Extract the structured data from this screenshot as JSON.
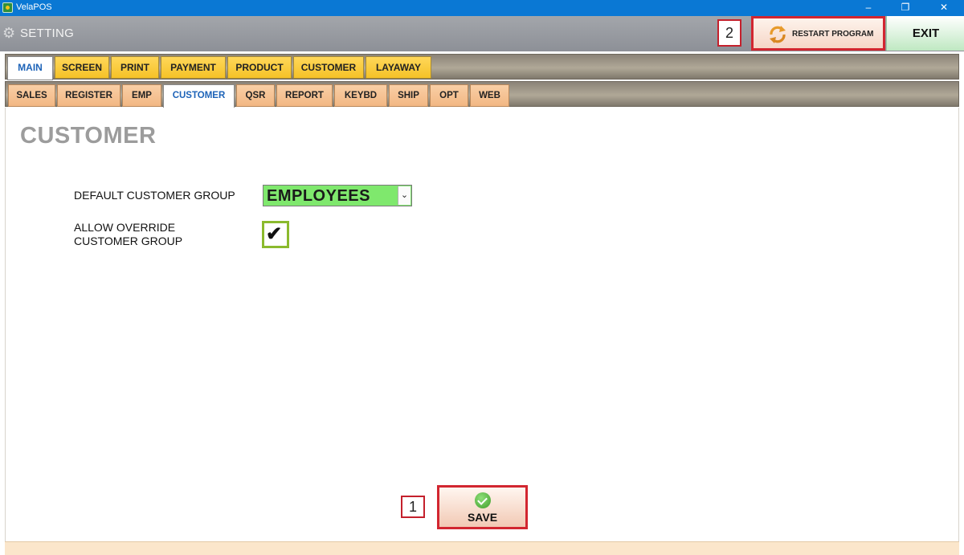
{
  "window": {
    "title": "VelaPOS",
    "min": "–",
    "max": "❐",
    "close": "✕"
  },
  "header": {
    "title": "SETTING",
    "restart_label": "RESTART PROGRAM",
    "exit_label": "EXIT",
    "callout_2": "2"
  },
  "main_tabs": [
    "MAIN",
    "SCREEN",
    "PRINT",
    "PAYMENT",
    "PRODUCT",
    "CUSTOMER",
    "LAYAWAY"
  ],
  "main_tab_active": "MAIN",
  "sub_tabs": [
    "SALES",
    "REGISTER",
    "EMP",
    "CUSTOMER",
    "QSR",
    "REPORT",
    "KEYBD",
    "SHIP",
    "OPT",
    "WEB"
  ],
  "sub_tab_active": "CUSTOMER",
  "page": {
    "title": "CUSTOMER",
    "default_group_label": "DEFAULT CUSTOMER GROUP",
    "default_group_value": "EMPLOYEES",
    "override_label_line1": "ALLOW OVERRIDE",
    "override_label_line2": "CUSTOMER GROUP",
    "override_checked": true,
    "check_glyph": "✔"
  },
  "save": {
    "label": "SAVE",
    "callout_1": "1"
  },
  "colors": {
    "titlebar": "#0a78d4",
    "header": "#959aa1",
    "main_tab": "#f5c227",
    "sub_tab": "#f2b783",
    "active_tab_text": "#1d63b8",
    "select_bg": "#7fe86d",
    "checkbox_border": "#8bba2d",
    "highlight_border": "#d22630"
  }
}
